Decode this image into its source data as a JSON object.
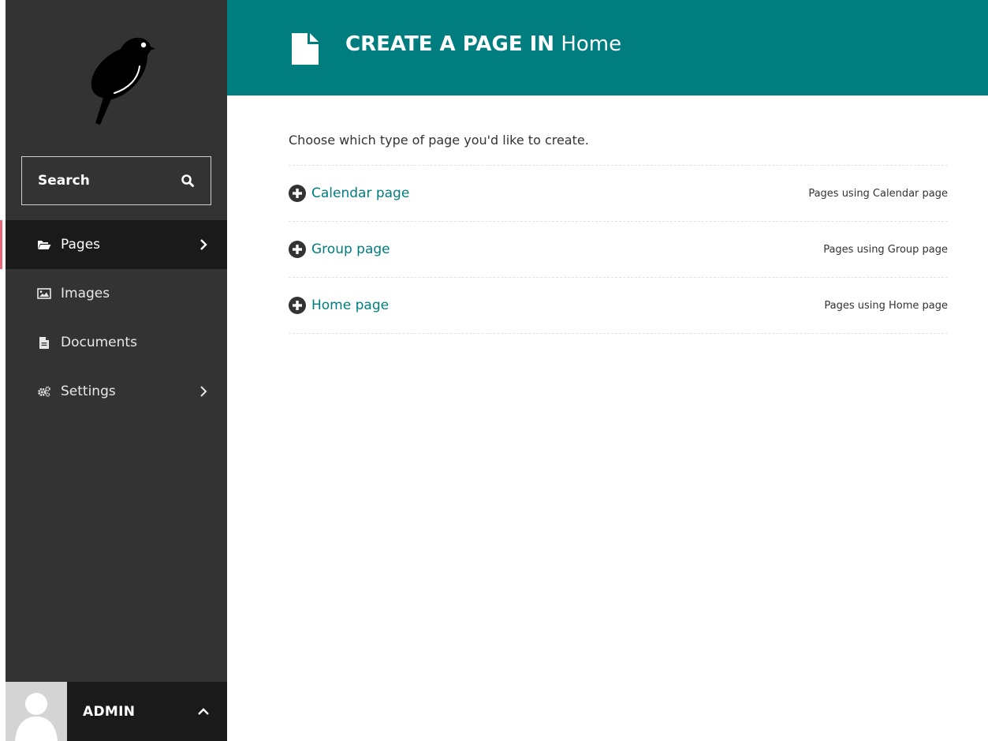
{
  "sidebar": {
    "search": {
      "label": "Search"
    },
    "nav": [
      {
        "label": "Pages",
        "icon": "folder-open-icon",
        "active": true,
        "has_submenu": true
      },
      {
        "label": "Images",
        "icon": "image-icon",
        "active": false,
        "has_submenu": false
      },
      {
        "label": "Documents",
        "icon": "document-icon",
        "active": false,
        "has_submenu": false
      },
      {
        "label": "Settings",
        "icon": "cogs-icon",
        "active": false,
        "has_submenu": true
      }
    ],
    "user": {
      "name": "ADMIN"
    }
  },
  "header": {
    "title_strong": "CREATE A PAGE IN",
    "title_light": "Home",
    "icon": "document-icon"
  },
  "main": {
    "intro": "Choose which type of page you'd like to create.",
    "page_types": [
      {
        "label": "Calendar page",
        "usage": "Pages using Calendar page"
      },
      {
        "label": "Group page",
        "usage": "Pages using Group page"
      },
      {
        "label": "Home page",
        "usage": "Pages using Home page"
      }
    ]
  },
  "colors": {
    "teal": "#007d7e",
    "sidebar": "#333333",
    "sidebar_dark": "#1a1a1a",
    "active_indicator": "#e9677a"
  }
}
